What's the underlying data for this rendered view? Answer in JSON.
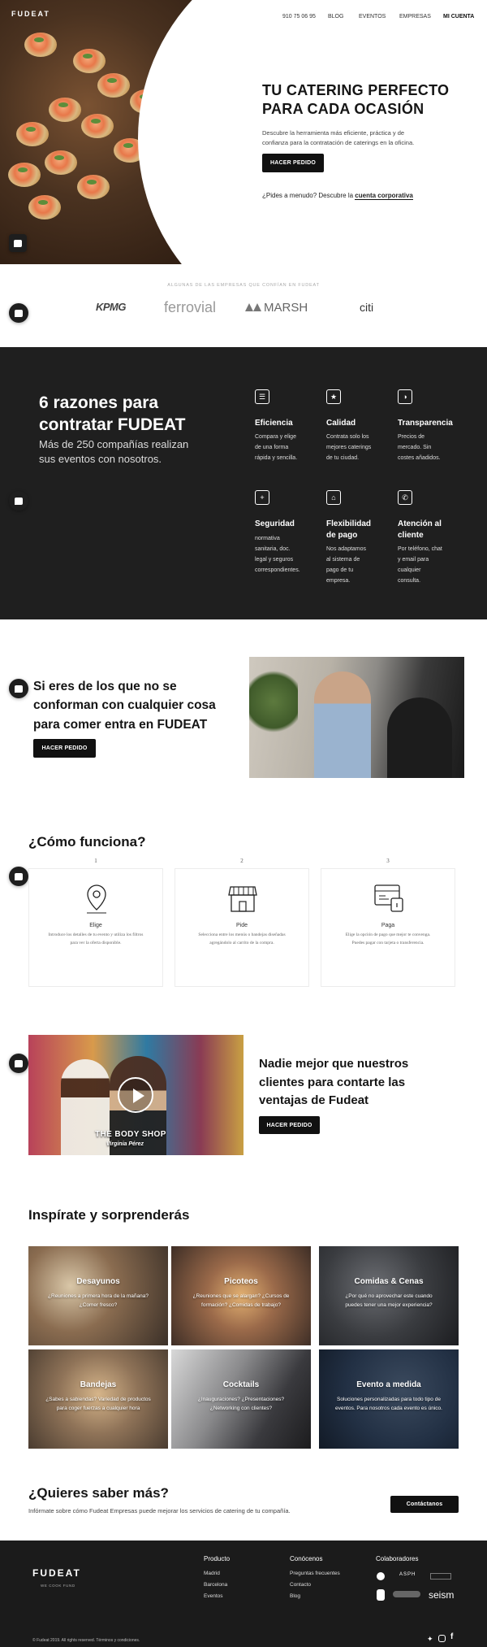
{
  "nav": {
    "logo": "FUDEAT",
    "phone": "910 75 06 95",
    "blog": "BLOG",
    "eventos": "EVENTOS",
    "empresas": "EMPRESAS",
    "account": "MI CUENTA"
  },
  "hero": {
    "title_line1": "TU CATERING PERFECTO",
    "title_line2": "PARA CADA OCASIÓN",
    "desc_line1": "Descubre la herramienta más eficiente, práctica y de",
    "desc_line2": "confianza para la contratación de caterings en la oficina.",
    "cta": "HACER PEDIDO",
    "menu_prefix": "¿Pides a menudo? Descubre la ",
    "menu_link": "cuenta corporativa"
  },
  "clients": {
    "caption": "ALGUNAS DE LAS EMPRESAS QUE CONFÍAN EN FUDEAT",
    "logos": [
      "KPMG",
      "ferrovial",
      "MARSH",
      "citi"
    ]
  },
  "reasons": {
    "heading_line1": "6 razones para",
    "heading_line2": "contratar FUDEAT",
    "sub_line1": "Más de 250 compañías realizan",
    "sub_line2": "sus eventos con nosotros.",
    "items": [
      {
        "icon": "list-icon",
        "title": "Eficiencia",
        "lines": [
          "Compara y elige",
          "de una forma",
          "rápida y sencilla."
        ]
      },
      {
        "icon": "star-icon",
        "title": "Calidad",
        "lines": [
          "Contrata solo los",
          "mejores caterings",
          "de tu ciudad."
        ]
      },
      {
        "icon": "contrast-icon",
        "title": "Transparencia",
        "lines": [
          "Precios de",
          "mercado. Sin",
          "costes añadidos."
        ]
      },
      {
        "icon": "plus-icon",
        "title": "Seguridad",
        "lines": [
          "normativa",
          "sanitaria, doc.",
          "legal y seguros",
          "correspondientes."
        ]
      },
      {
        "icon": "bank-icon",
        "title_lines": [
          "Flexibilidad",
          "de pago"
        ],
        "lines": [
          "Nos adaptamos",
          "al sistema de",
          "pago de tu",
          "empresa."
        ]
      },
      {
        "icon": "phone-icon",
        "title_lines": [
          "Atención al",
          "cliente"
        ],
        "lines": [
          "Por teléfono, chat",
          "y email para",
          "cualquier",
          "consulta."
        ]
      }
    ]
  },
  "conform": {
    "line1": "Si eres de los que no se",
    "line2": "conforman con cualquier cosa",
    "line3": "para comer entra en FUDEAT",
    "cta": "HACER PEDIDO"
  },
  "how": {
    "heading": "¿Cómo funciona?",
    "steps": [
      {
        "num": "1",
        "icon": "map-pin-icon",
        "title": "Elige",
        "lines": [
          "Introduce los detalles de tu evento y utiliza los filtros",
          "para ver la oferta disponible."
        ]
      },
      {
        "num": "2",
        "icon": "shop-icon",
        "title": "Pide",
        "lines": [
          "Selecciona entre los menús o bandejas diseñadas",
          "agregándolo al carrito de la compra."
        ]
      },
      {
        "num": "3",
        "icon": "payment-icon",
        "title": "Paga",
        "lines": [
          "Elige la opción de pago que mejor te convenga.",
          "Puedes pagar con tarjeta o transferencia."
        ]
      }
    ]
  },
  "video": {
    "brand": "THE BODY SHOP",
    "person": "Virginia Pérez",
    "line1": "Nadie mejor que nuestros",
    "line2": "clientes para contarte las",
    "line3": "ventajas de Fudeat",
    "cta": "HACER PEDIDO"
  },
  "inspire": {
    "heading": "Inspírate y sorprenderás",
    "tiles": [
      {
        "title": "Desayunos",
        "lines": [
          "¿Reuniones a primera hora de la mañana?",
          "¿Comer fresco?"
        ],
        "color": "#5b4a3c"
      },
      {
        "title": "Picoteos",
        "lines": [
          "¿Reuniones que se alargan? ¿Cursos de",
          "formación? ¿Comidas de trabajo?"
        ],
        "color": "#6b5648"
      },
      {
        "title": "Comidas & Cenas",
        "lines": [
          "¿Por qué no aprovechar este cuando",
          "puedes tener una mejor experiencia?"
        ],
        "color": "#2f3136"
      },
      {
        "title": "Bandejas",
        "lines": [
          "¿Sabes a sabiendas? Variedad de productos",
          "para coger fuerzas a cualquier hora"
        ],
        "color": "#7a6a5a"
      },
      {
        "title": "Cocktails",
        "lines": [
          "¿Inauguraciones? ¿Presentaciones?",
          "¿Networking con clientes?"
        ],
        "color": "#4a4a4e"
      },
      {
        "title": "Evento a medida",
        "lines": [
          "Soluciones personalizadas para todo tipo de",
          "eventos. Para nosotros cada evento es único."
        ],
        "color": "#263242"
      }
    ]
  },
  "more": {
    "heading": "¿Quieres saber más?",
    "text": "Infórmate sobre cómo Fudeat Empresas puede mejorar los servicios de catering de tu compañía.",
    "cta": "Contáctanos"
  },
  "footer": {
    "logo": "FUDEAT",
    "tagline": "WE COOK FUND",
    "col1_title": "Producto",
    "col1_links": [
      "Madrid",
      "Barcelona",
      "Eventos"
    ],
    "col2_title": "Conócenos",
    "col2_links": [
      "Preguntas frecuentes",
      "Contacto",
      "Blog"
    ],
    "col3_title": "Colaboradores",
    "partners": [
      "ASPH",
      "seism"
    ],
    "copyright": "© Fudeat 2019. All rights reserved. Términos y condiciones."
  }
}
